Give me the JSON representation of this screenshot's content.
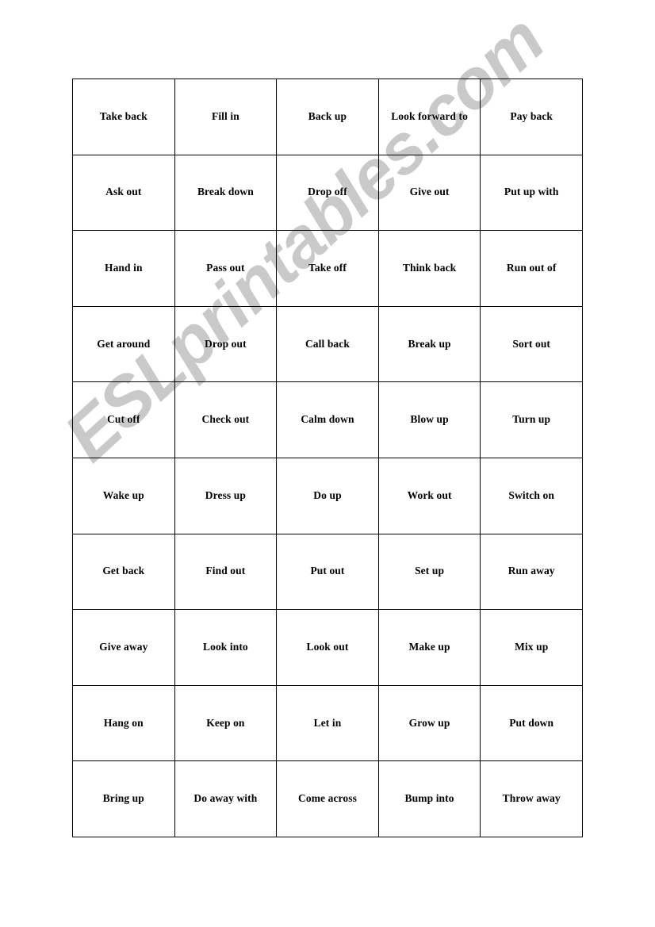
{
  "document": {
    "type": "worksheet",
    "subject": "Phrasal verbs domino cards grid",
    "watermark": "ESLprintables.com",
    "watermark_color": "#c9c9c9",
    "page_background": "#ffffff",
    "border_color": "#000000",
    "text_color": "#000000"
  },
  "grid": {
    "columns": 5,
    "rows": 10,
    "cells": [
      [
        "Take back",
        "Fill in",
        "Back up",
        "Look forward to",
        "Pay back"
      ],
      [
        "Ask out",
        "Break down",
        "Drop off",
        "Give out",
        "Put up with"
      ],
      [
        "Hand in",
        "Pass out",
        "Take off",
        "Think back",
        "Run out of"
      ],
      [
        "Get around",
        "Drop out",
        "Call back",
        "Break up",
        "Sort out"
      ],
      [
        "Cut off",
        "Check out",
        "Calm down",
        "Blow up",
        "Turn up"
      ],
      [
        "Wake up",
        "Dress up",
        "Do up",
        "Work out",
        "Switch on"
      ],
      [
        "Get back",
        "Find out",
        "Put out",
        "Set up",
        "Run away"
      ],
      [
        "Give away",
        "Look into",
        "Look out",
        "Make up",
        "Mix up"
      ],
      [
        "Hang on",
        "Keep on",
        "Let in",
        "Grow up",
        "Put down"
      ],
      [
        "Bring up",
        "Do away with",
        "Come across",
        "Bump into",
        "Throw away"
      ]
    ]
  }
}
